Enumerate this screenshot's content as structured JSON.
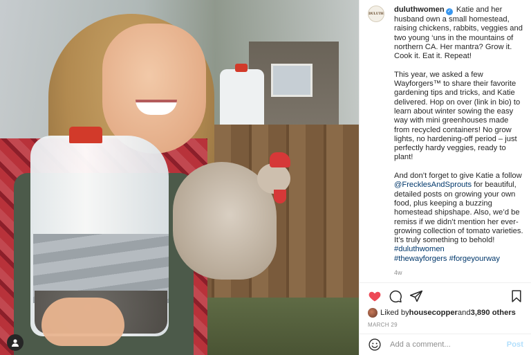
{
  "post": {
    "username": "duluthwomen",
    "avatar_text": "DULUTH",
    "caption_intro": " Katie and her husband own a small homestead, raising chickens, rabbits, veggies and two young ‘uns in the mountains of northern CA. Her mantra? Grow it. Cook it. Eat it. Repeat!",
    "caption_p2": "This year, we asked a few Wayforgers™ to share their favorite gardening tips and tricks, and Katie delivered. Hop on over (link in bio) to learn about winter sowing the easy way with mini greenhouses made from recycled containers! No grow lights, no hardening-off period – just perfectly hardy veggies, ready to plant!",
    "caption_p3_a": "And don’t forget to give Katie a follow ",
    "mention": "@FrecklesAndSprouts",
    "caption_p3_b": " for beautiful, detailed posts on growing your own food, plus keeping a buzzing homestead shipshape. Also, we’d be remiss if we didn’t mention her ever-growing collection of tomato varieties. It’s truly something to behold! ",
    "hashtag1": "#duluthwomen",
    "hashtag2": "#thewayforgers",
    "hashtag3": "#forgeyourway",
    "time_ago": "4w",
    "verified_symbol": "✓"
  },
  "likes": {
    "prefix": "Liked by ",
    "user": "housecopper",
    "and": " and ",
    "count": "3,890 others"
  },
  "date": "MARCH 29",
  "comment": {
    "placeholder": "Add a comment...",
    "post_label": "Post"
  },
  "icons": {
    "like": "heart-icon",
    "comment": "comment-icon",
    "share": "share-icon",
    "save": "bookmark-icon",
    "emoji": "emoji-icon",
    "tag": "user-tag-icon"
  },
  "colors": {
    "heart": "#ed4956",
    "link": "#00376b",
    "verified": "#3897f0",
    "post_button": "#b2dffc"
  }
}
